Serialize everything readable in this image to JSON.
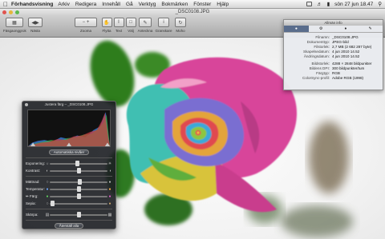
{
  "menubar": {
    "app": "Förhandsvisning",
    "menus": [
      "Arkiv",
      "Redigera",
      "Innehåll",
      "Gå",
      "Verktyg",
      "Bokmärken",
      "Fönster",
      "Hjälp"
    ],
    "clock": "sön 27 jun  18.47"
  },
  "window": {
    "title": "_DSC0108.JPG",
    "toolbar": {
      "sidebar": "Fäsgaonggrok",
      "back": "Nästa",
      "zoom": "Zooma",
      "move": "Flytta",
      "text": "Text",
      "select": "Välj",
      "annotate": "Anteckna",
      "inspector": "Granskare",
      "rotate": "Moho"
    }
  },
  "info_panel": {
    "header": "Allmän info",
    "rows": [
      {
        "k": "Filnamn:",
        "v": "_DSC0108.JPG"
      },
      {
        "k": "Dokumenttyp:",
        "v": "JPEG-bild"
      },
      {
        "k": "Filstorlek:",
        "v": "2,7 MB (2 682 287 byte)"
      },
      {
        "k": "Skapelsedatum:",
        "v": "4 jun 2010 14.52"
      },
      {
        "k": "Ändringsdatum:",
        "v": "4 jun 2010 14.52"
      }
    ],
    "rows2": [
      {
        "k": "Bildstorlek:",
        "v": "4288 × 2848 bildpunkter"
      },
      {
        "k": "Bildens DPI:",
        "v": "300 bildpunkter/tum"
      },
      {
        "k": "Färgtyp:",
        "v": "RGB"
      },
      {
        "k": "ColorSync-profil:",
        "v": "Adobe RGB (1998)"
      }
    ]
  },
  "adjust_panel": {
    "title": "Justera färg – _DSC0108.JPG",
    "auto_button": "Automatiska nivåer",
    "reset_button": "Återställ alla",
    "sliders": [
      {
        "label": "Exponering:",
        "value": 0.48
      },
      {
        "label": "Kontrast:",
        "value": 0.5
      },
      {
        "label": "Mättnad:",
        "value": 0.52
      },
      {
        "label": "Temperatur:",
        "value": 0.5
      },
      {
        "label": "Färg:",
        "value": 0.5
      },
      {
        "label": "Sepia:",
        "value": 0.05
      },
      {
        "label": "Skärpa:",
        "value": 0.5
      }
    ]
  },
  "colors": {
    "panel_dark": "#1c1e22",
    "tab_active": "#5a6d8c"
  }
}
